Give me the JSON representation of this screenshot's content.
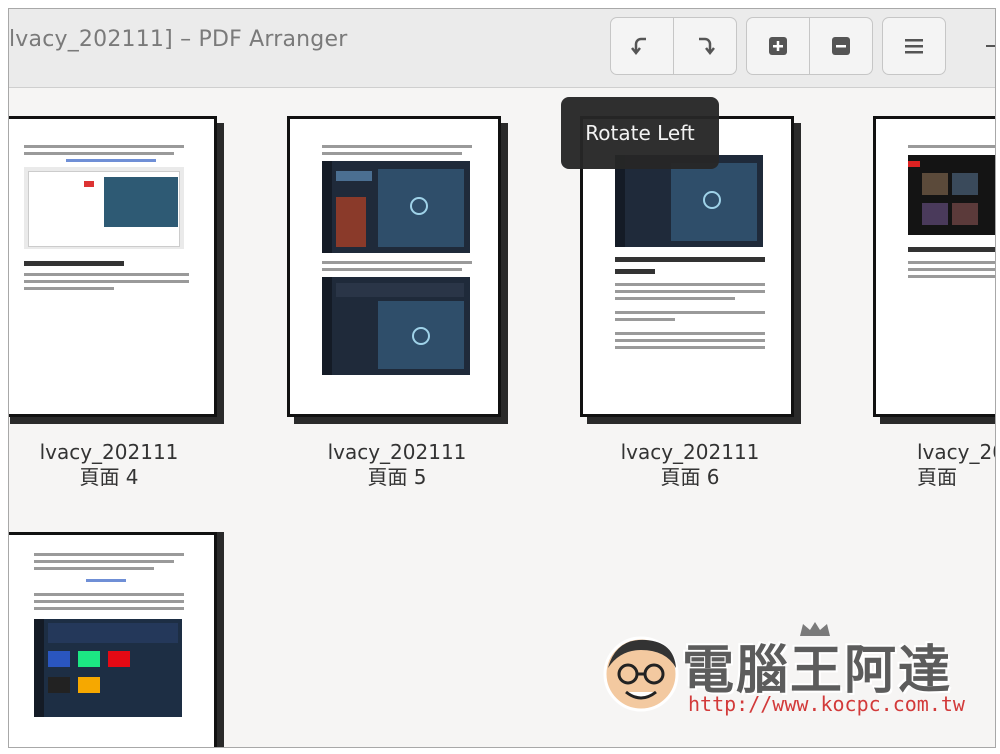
{
  "window": {
    "title": "lvacy_202111] – PDF Arranger"
  },
  "toolbar": {
    "rotate_left_icon": "rotate-left-icon",
    "rotate_right_icon": "rotate-right-icon",
    "zoom_in_icon": "zoom-in-icon",
    "zoom_out_icon": "zoom-out-icon",
    "menu_icon": "hamburger-menu-icon"
  },
  "tooltip": {
    "text": "Rotate Left"
  },
  "pages": [
    {
      "file": "lvacy_202111",
      "page_label": "頁面 4"
    },
    {
      "file": "lvacy_202111",
      "page_label": "頁面 5"
    },
    {
      "file": "lvacy_202111",
      "page_label": "頁面 6"
    },
    {
      "file": "lvacy_20",
      "page_label": "頁面"
    },
    {
      "file": "",
      "page_label": ""
    }
  ],
  "watermark": {
    "brand": "電腦王阿達",
    "url": "http://www.kocpc.com.tw"
  },
  "colors": {
    "headerbar": "#ebebeb",
    "background": "#f6f5f4",
    "tooltip": "#262626",
    "watermark_url": "#d23a3a"
  }
}
